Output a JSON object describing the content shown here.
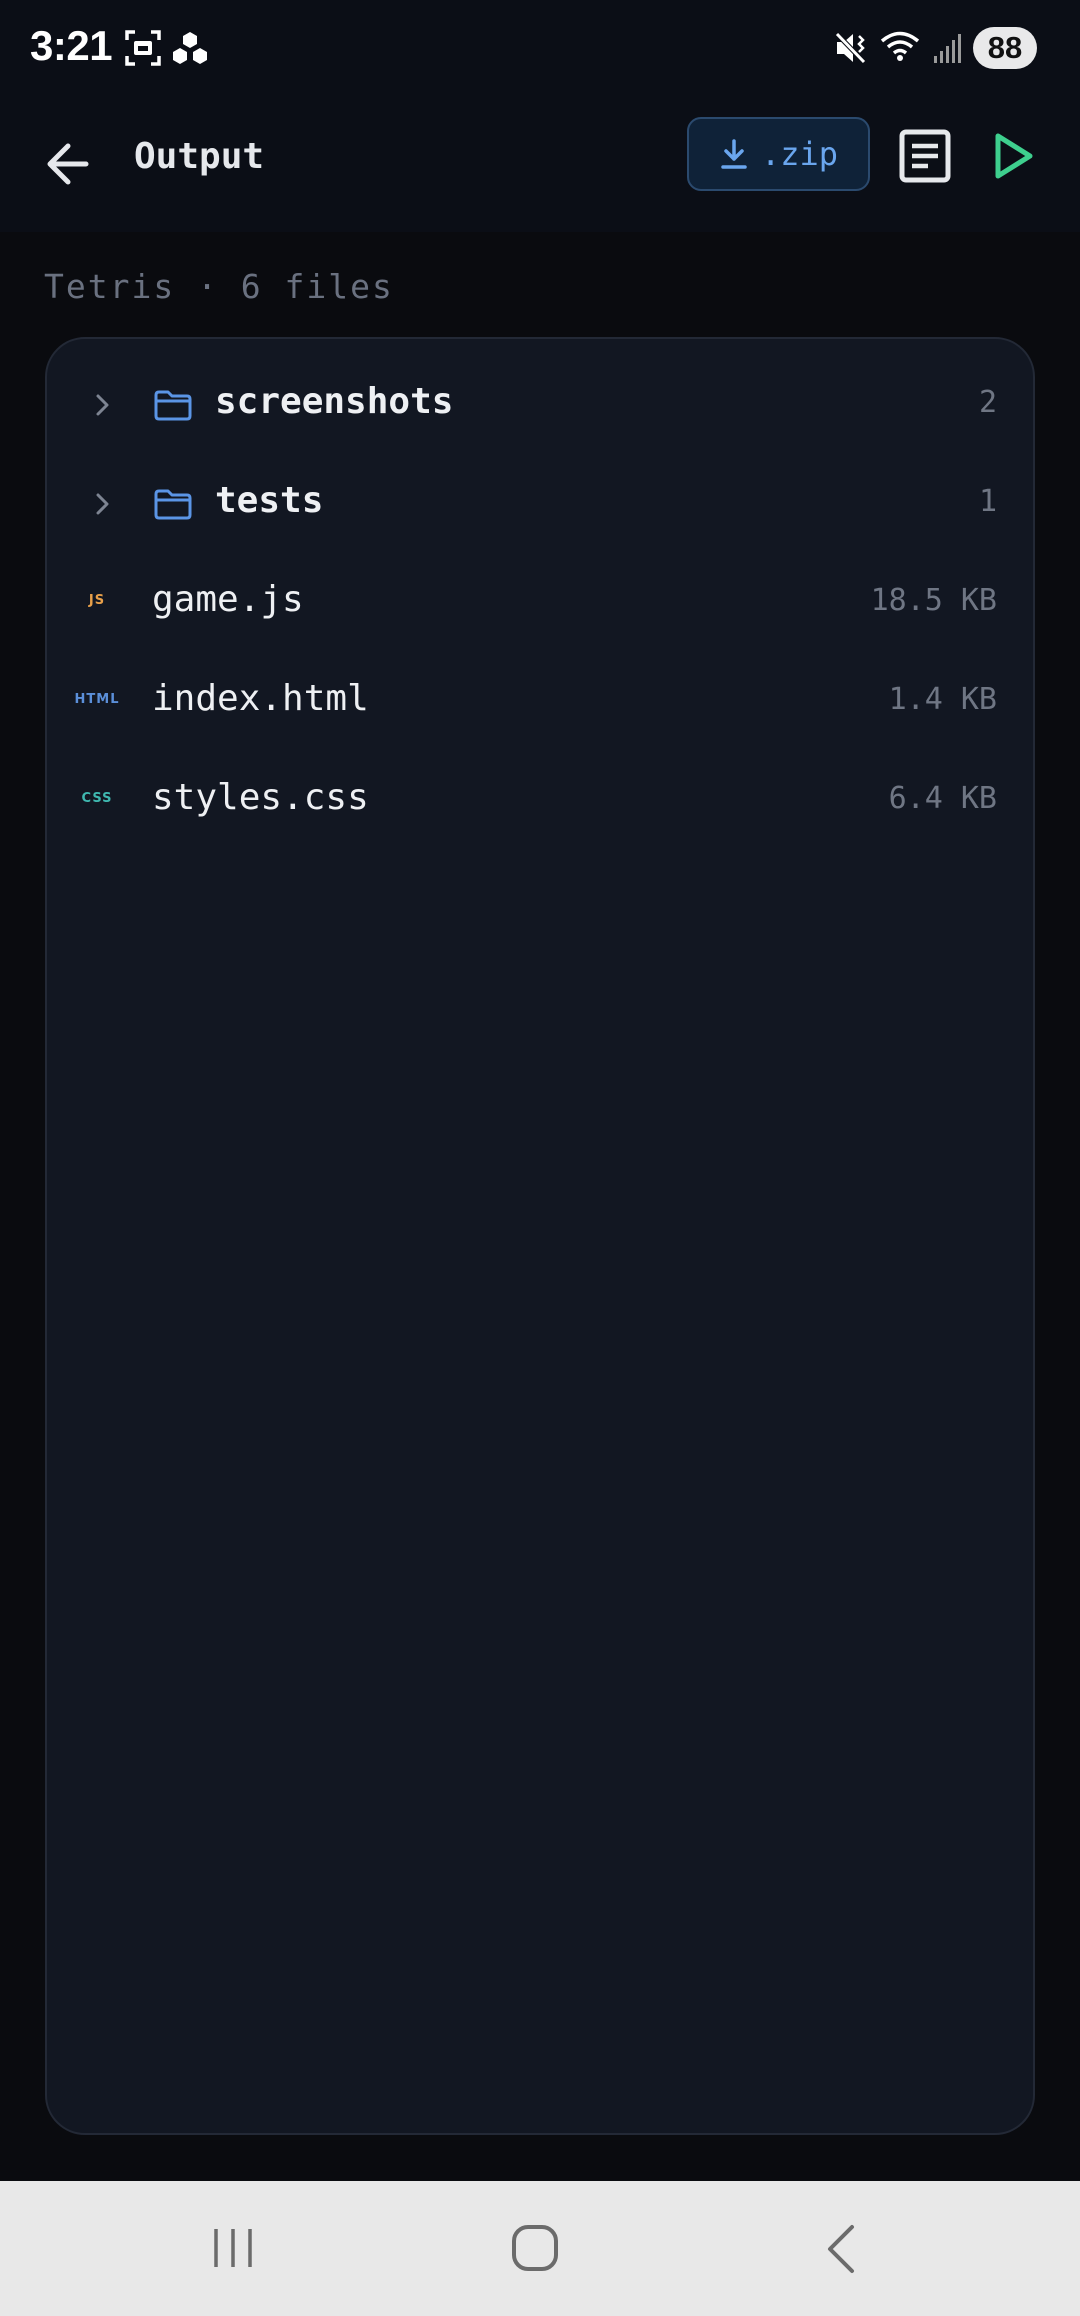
{
  "status_bar": {
    "time": "3:21",
    "battery": "88",
    "icons": [
      "screenshot-icon",
      "cluster-app-icon",
      "mute-vibrate-icon",
      "wifi-icon",
      "signal-icon",
      "battery-icon"
    ]
  },
  "app_bar": {
    "title": "Output",
    "zip_label": ".zip",
    "icons": [
      "back-arrow-icon",
      "download-icon",
      "document-icon",
      "play-icon"
    ]
  },
  "project": {
    "summary": "Tetris · 6 files"
  },
  "files": [
    {
      "kind": "folder",
      "name": "screenshots",
      "meta": "2",
      "icon": "folder-icon"
    },
    {
      "kind": "folder",
      "name": "tests",
      "meta": "1",
      "icon": "folder-icon"
    },
    {
      "kind": "file",
      "name": "game.js",
      "meta": "18.5 KB",
      "ext": "JS",
      "ext_color": "#e8a04a"
    },
    {
      "kind": "file",
      "name": "index.html",
      "meta": "1.4 KB",
      "ext": "HTML",
      "ext_color": "#5b8fd9"
    },
    {
      "kind": "file",
      "name": "styles.css",
      "meta": "6.4 KB",
      "ext": "CSS",
      "ext_color": "#3fb8b0"
    }
  ],
  "colors": {
    "accent_blue": "#6aa6ee",
    "play_green": "#3ecf8e",
    "background": "#0a0b0f",
    "panel": "#121722"
  },
  "nav_bar": {
    "buttons": [
      "recents-icon",
      "home-icon",
      "back-icon"
    ]
  }
}
